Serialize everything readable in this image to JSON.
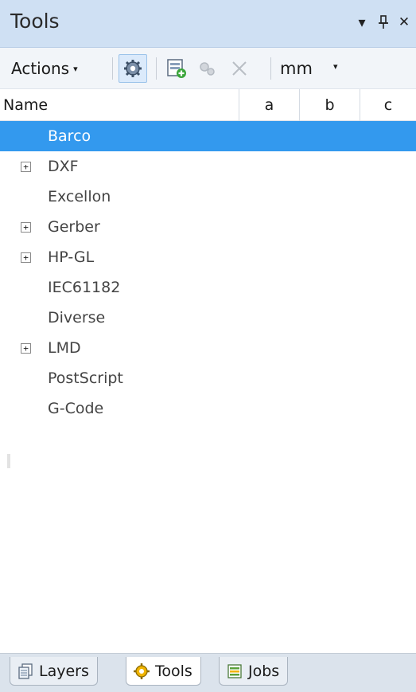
{
  "window": {
    "title": "Tools",
    "menu_glyph": "▾",
    "pin_glyph": "ᛘ",
    "close_glyph": "✕"
  },
  "toolbar": {
    "actions_label": "Actions",
    "actions_caret": "▾",
    "unit_value": "mm",
    "unit_caret": "▾"
  },
  "columns": {
    "name": "Name",
    "a": "a",
    "b": "b",
    "c": "c"
  },
  "tree": [
    {
      "label": "Barco",
      "expandable": false,
      "selected": true
    },
    {
      "label": "DXF",
      "expandable": true,
      "selected": false
    },
    {
      "label": "Excellon",
      "expandable": false,
      "selected": false
    },
    {
      "label": "Gerber",
      "expandable": true,
      "selected": false
    },
    {
      "label": "HP-GL",
      "expandable": true,
      "selected": false
    },
    {
      "label": "IEC61182",
      "expandable": false,
      "selected": false
    },
    {
      "label": "Diverse",
      "expandable": false,
      "selected": false
    },
    {
      "label": "LMD",
      "expandable": true,
      "selected": false
    },
    {
      "label": "PostScript",
      "expandable": false,
      "selected": false
    },
    {
      "label": "G-Code",
      "expandable": false,
      "selected": false
    }
  ],
  "expander_glyph": "+",
  "tabs": {
    "layers": "Layers",
    "tools": "Tools",
    "jobs": "Jobs"
  },
  "colors": {
    "title_bg": "#cfe0f3",
    "selection": "#3399ee"
  }
}
